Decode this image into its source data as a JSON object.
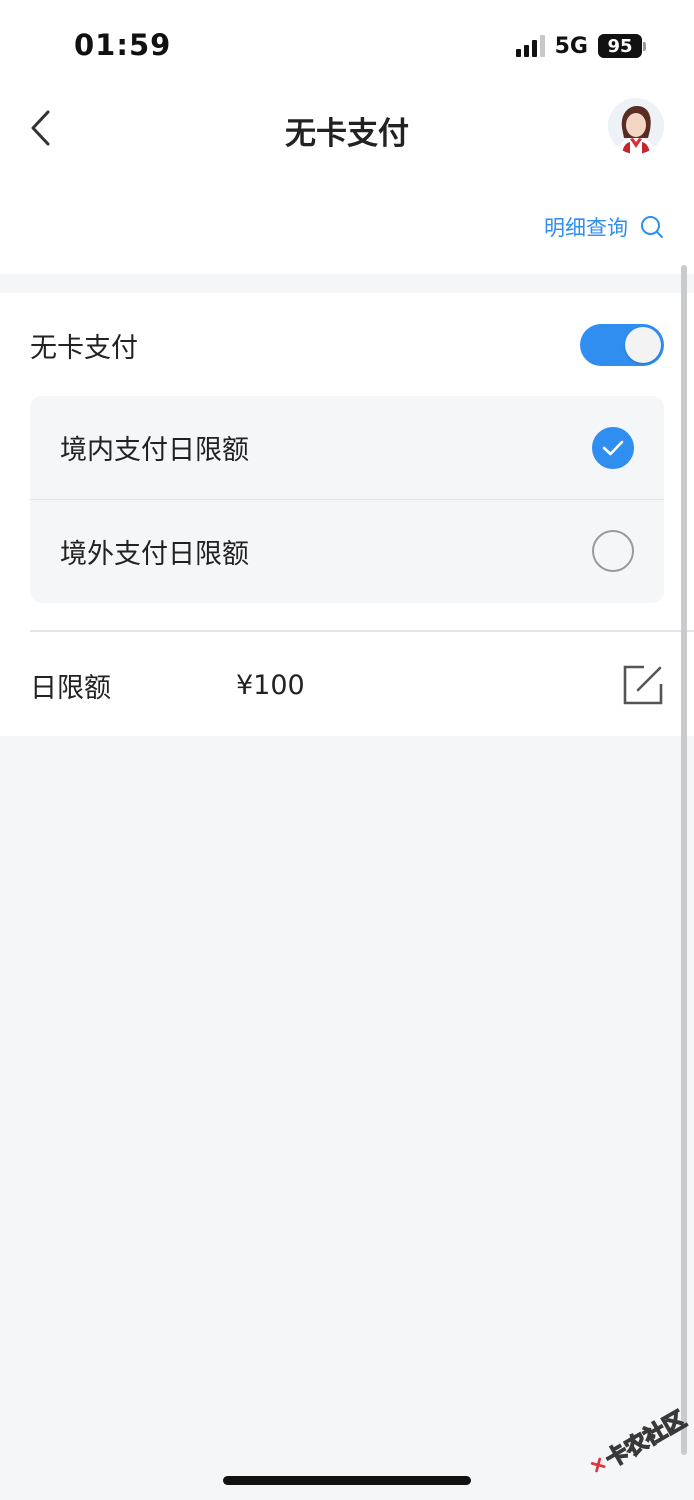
{
  "status_bar": {
    "time": "01:59",
    "network": "5G",
    "battery": "95"
  },
  "nav": {
    "title": "无卡支付"
  },
  "detail": {
    "label": "明细查询"
  },
  "settings": {
    "toggle_label": "无卡支付",
    "toggle_on": true,
    "options": [
      {
        "label": "境内支付日限额",
        "checked": true
      },
      {
        "label": "境外支付日限额",
        "checked": false
      }
    ],
    "limit_label": "日限额",
    "limit_value": "¥100"
  },
  "watermark": {
    "text": "卡农社区"
  },
  "colors": {
    "accent": "#2f8ef0",
    "background": "#f5f6f8",
    "text": "#222222"
  }
}
